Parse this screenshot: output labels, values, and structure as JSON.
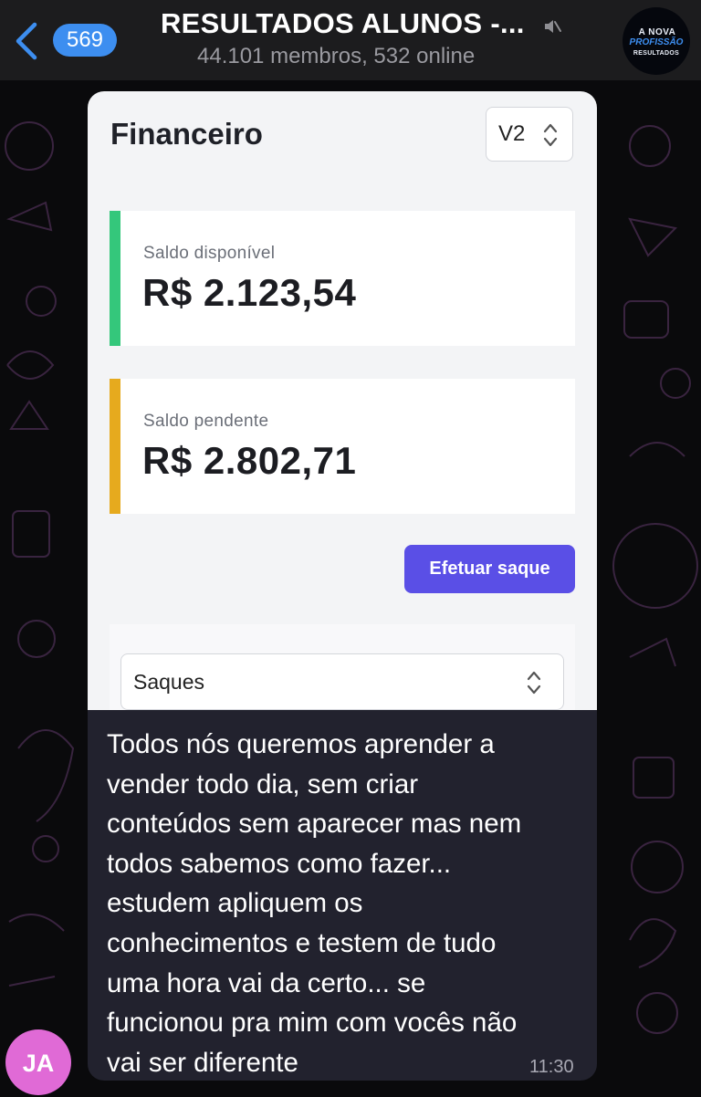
{
  "header": {
    "unread_count": "569",
    "chat_title": "RESULTADOS ALUNOS -...",
    "subtitle": "44.101 membros, 532 online",
    "logo": {
      "line1": "A NOVA",
      "line2": "PROFISSÃO",
      "line3": "RESULTADOS"
    },
    "icons": [
      "chevron-left-icon",
      "mute-icon"
    ]
  },
  "shared_screenshot": {
    "title": "Financeiro",
    "version_select": {
      "value": "V2"
    },
    "balances": [
      {
        "label": "Saldo disponível",
        "value": "R$ 2.123,54",
        "accent_color": "#34c77b"
      },
      {
        "label": "Saldo pendente",
        "value": "R$ 2.802,71",
        "accent_color": "#e6aa1e"
      }
    ],
    "withdraw_button": "Efetuar saque",
    "type_select": {
      "value": "Saques"
    }
  },
  "message": {
    "text": "Todos nós queremos aprender a\nvender todo dia, sem criar\nconteúdos sem aparecer mas nem\ntodos sabemos como fazer...\nestudem apliquem os\nconhecimentos e testem de tudo\numa hora vai da certo... se\nfuncionou pra mim com vocês não\nvai ser diferente",
    "time": "11:30",
    "sender_initials": "JA"
  },
  "colors": {
    "accent_blue": "#3d8ef0",
    "button_purple": "#5a4fe6",
    "bubble_bg": "#22222e",
    "sender_avatar": "#e06ad6"
  }
}
